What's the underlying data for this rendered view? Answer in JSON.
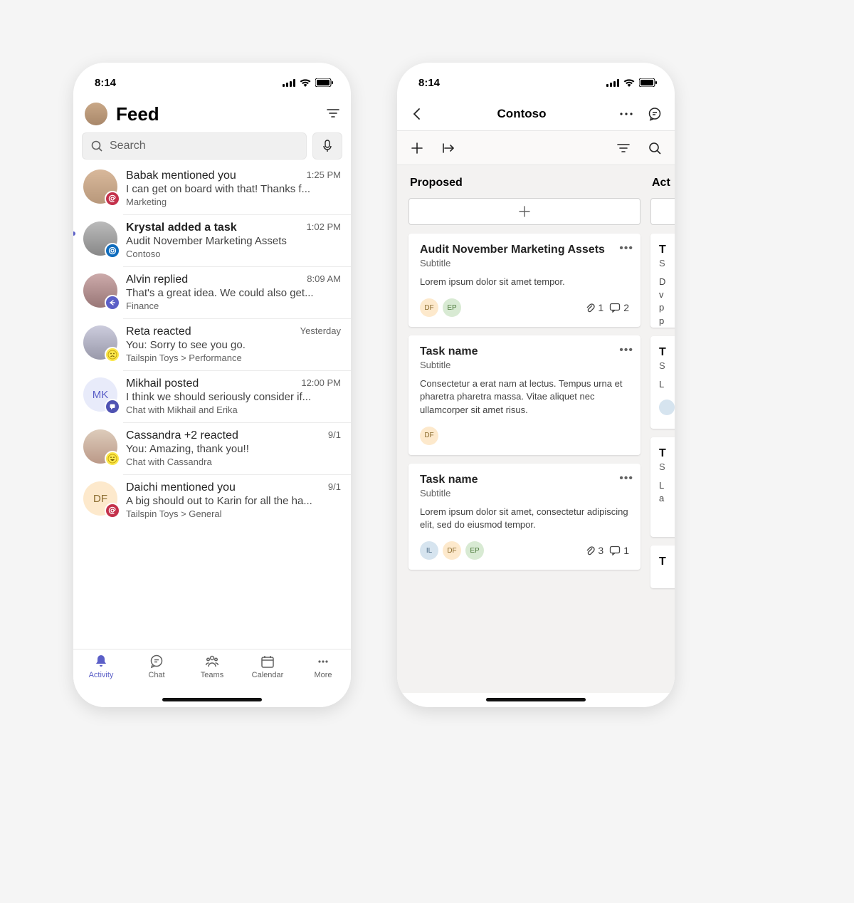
{
  "status": {
    "time": "8:14"
  },
  "feed": {
    "title": "Feed",
    "search_placeholder": "Search",
    "items": [
      {
        "title": "Babak mentioned you",
        "time": "1:25 PM",
        "snippet": "I can get on board with that! Thanks f...",
        "location": "Marketing",
        "badge": "mention",
        "bold": false,
        "unread": false
      },
      {
        "title": "Krystal added a task",
        "time": "1:02 PM",
        "snippet": "Audit November Marketing Assets",
        "location": "Contoso",
        "badge": "task",
        "bold": true,
        "unread": true
      },
      {
        "title": "Alvin replied",
        "time": "8:09 AM",
        "snippet": "That's a great idea. We could also get...",
        "location": "Finance",
        "badge": "reply",
        "bold": false,
        "unread": false
      },
      {
        "title": "Reta reacted",
        "time": "Yesterday",
        "snippet": "You: Sorry to see you go.",
        "location": "Tailspin Toys > Performance",
        "badge": "sad",
        "bold": false,
        "unread": false
      },
      {
        "title": "Mikhail posted",
        "time": "12:00 PM",
        "snippet": "I think we should seriously consider if...",
        "location": "Chat with Mikhail and Erika",
        "badge": "post",
        "bold": false,
        "unread": false,
        "initials": "MK"
      },
      {
        "title": "Cassandra +2 reacted",
        "time": "9/1",
        "snippet": "You: Amazing, thank you!!",
        "location": "Chat with Cassandra",
        "badge": "laugh",
        "bold": false,
        "unread": false
      },
      {
        "title": "Daichi mentioned you",
        "time": "9/1",
        "snippet": "A big should out to Karin for all the ha...",
        "location": "Tailspin Toys > General",
        "badge": "mention",
        "bold": false,
        "unread": false,
        "initials": "DF"
      }
    ]
  },
  "tabs": {
    "activity": "Activity",
    "chat": "Chat",
    "teams": "Teams",
    "calendar": "Calendar",
    "more": "More"
  },
  "board": {
    "title": "Contoso",
    "columns": [
      {
        "name": "Proposed",
        "cards": [
          {
            "title": "Audit November Marketing Assets",
            "subtitle": "Subtitle",
            "desc": "Lorem ipsum dolor sit amet tempor.",
            "chips": [
              "DF",
              "EP"
            ],
            "attachments": 1,
            "comments": 2
          },
          {
            "title": "Task name",
            "subtitle": "Subtitle",
            "desc": "Consectetur a erat nam at lectus. Tempus urna et pharetra pharetra massa. Vitae aliquet nec ullamcorper sit amet risus.",
            "chips": [
              "DF"
            ],
            "attachments": null,
            "comments": null
          },
          {
            "title": "Task name",
            "subtitle": "Subtitle",
            "desc": "Lorem ipsum dolor sit amet, consectetur adipiscing elit, sed do eiusmod tempor.",
            "chips": [
              "IL",
              "DF",
              "EP"
            ],
            "attachments": 3,
            "comments": 1
          }
        ]
      },
      {
        "name": "Act",
        "peek": [
          {
            "title": "T",
            "sub": "S",
            "lines": [
              "D",
              "v",
              "p",
              "p"
            ]
          },
          {
            "title": "T",
            "sub": "S",
            "lines": [
              "L"
            ]
          },
          {
            "title": "T",
            "sub": "S",
            "lines": [
              "L",
              "a"
            ]
          },
          {
            "title": "T",
            "sub": "",
            "lines": []
          }
        ]
      }
    ]
  }
}
